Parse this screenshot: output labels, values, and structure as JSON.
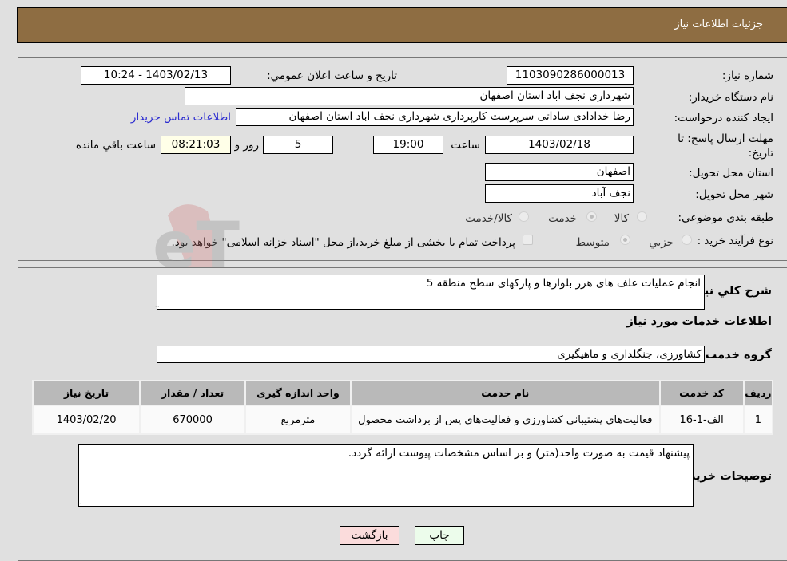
{
  "header": {
    "title": "جزئيات اطلاعات نياز"
  },
  "details": {
    "need_number": {
      "label": "شماره نیاز:",
      "value": "1103090286000013"
    },
    "announce_datetime": {
      "label": "تاريخ و ساعت اعلان عمومي:",
      "value": "1403/02/13 - 10:24"
    },
    "buyer_org": {
      "label": "نام دستگاه خریدار:",
      "value": "شهرداری نجف اباد استان اصفهان"
    },
    "requester": {
      "label": "ایجاد کننده درخواست:",
      "value": "رضا خدادادی ساداتی سرپرست  کارپردازی شهرداری نجف اباد استان اصفهان"
    },
    "buyer_contact_link": "اطلاعات تماس خریدار",
    "deadline": {
      "label": "مهلت ارسال پاسخ: تا تاریخ:",
      "date": "1403/02/18",
      "time_label": "ساعت",
      "time": "19:00",
      "days": "5",
      "days_label": "روز و",
      "remaining": "08:21:03",
      "remaining_label": "ساعت باقي مانده"
    },
    "delivery_province": {
      "label": "استان محل تحویل:",
      "value": "اصفهان"
    },
    "delivery_city": {
      "label": "شهر محل تحویل:",
      "value": "نجف آباد"
    },
    "category": {
      "label": "طبقه بندی موضوعی:",
      "options": [
        "کالا",
        "خدمت",
        "کالا/خدمت"
      ],
      "selected": "خدمت"
    },
    "purchase_type": {
      "label": "نوع فرآیند خرید :",
      "options": [
        "جزيي",
        "متوسط"
      ],
      "selected": "متوسط",
      "treasury_note": "پرداخت تمام یا بخشی از مبلغ خرید،از محل \"اسناد خزانه اسلامی\" خواهد بود."
    }
  },
  "description": {
    "label": "شرح كلي نياز:",
    "value": "انجام عملیات علف های هرز بلوارها و پارکهای سطح منطقه 5"
  },
  "services": {
    "section_title": "اطلاعات خدمات مورد نياز",
    "group_label": "گروه خدمت:",
    "group_value": "کشاورزی، جنگلداری و ماهیگیری",
    "table": {
      "headers": [
        "رديف",
        "كد خدمت",
        "نام خدمت",
        "واحد اندازه گیری",
        "تعداد / مقدار",
        "تاريخ نياز"
      ],
      "rows": [
        [
          "1",
          "الف-1-16",
          "فعالیت‌های پشتیبانی کشاورزی و فعالیت‌های پس از برداشت محصول",
          "مترمربع",
          "670000",
          "1403/02/20"
        ]
      ]
    }
  },
  "buyer_notes": {
    "label": "توضيحات خريدار:",
    "value": "پیشنهاد قیمت به صورت واحد(متر) و بر اساس مشخصات پیوست ارائه گردد."
  },
  "buttons": {
    "print": "چاپ",
    "back": "بازگشت"
  },
  "watermark": "AriaTender.neT"
}
